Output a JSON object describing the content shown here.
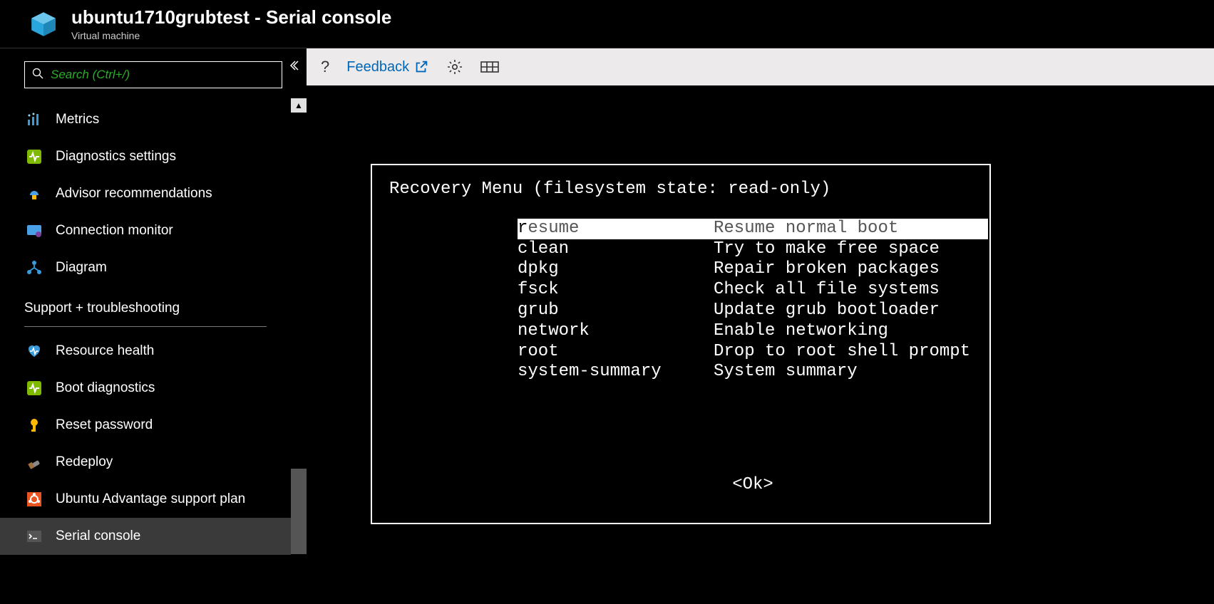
{
  "header": {
    "title": "ubuntu1710grubtest - Serial console",
    "subtitle": "Virtual machine"
  },
  "search": {
    "placeholder": "Search (Ctrl+/)"
  },
  "sidebar": {
    "items": [
      {
        "label": "Metrics",
        "color": "#3a9bdc"
      },
      {
        "label": "Diagnostics settings",
        "color": "#7fba00"
      },
      {
        "label": "Advisor recommendations",
        "color": "#ffb900"
      },
      {
        "label": "Connection monitor",
        "color": "#4aa0e6"
      },
      {
        "label": "Diagram",
        "color": "#3a9bdc"
      }
    ],
    "section_label": "Support + troubleshooting",
    "support_items": [
      {
        "label": "Resource health",
        "color": "#3a9bdc"
      },
      {
        "label": "Boot diagnostics",
        "color": "#7fba00"
      },
      {
        "label": "Reset password",
        "color": "#ffb900"
      },
      {
        "label": "Redeploy",
        "color": "#888"
      },
      {
        "label": "Ubuntu Advantage support plan",
        "color": "#e95420"
      },
      {
        "label": "Serial console",
        "color": "#888",
        "active": true
      }
    ]
  },
  "toolbar": {
    "help": "?",
    "feedback": "Feedback"
  },
  "console": {
    "title": "Recovery Menu (filesystem state: read-only)",
    "menu": [
      {
        "key": "resume",
        "desc": "Resume normal boot",
        "selected": true
      },
      {
        "key": "clean",
        "desc": "Try to make free space"
      },
      {
        "key": "dpkg",
        "desc": "Repair broken packages"
      },
      {
        "key": "fsck",
        "desc": "Check all file systems"
      },
      {
        "key": "grub",
        "desc": "Update grub bootloader"
      },
      {
        "key": "network",
        "desc": "Enable networking"
      },
      {
        "key": "root",
        "desc": "Drop to root shell prompt"
      },
      {
        "key": "system-summary",
        "desc": "System summary"
      }
    ],
    "ok": "<Ok>"
  }
}
